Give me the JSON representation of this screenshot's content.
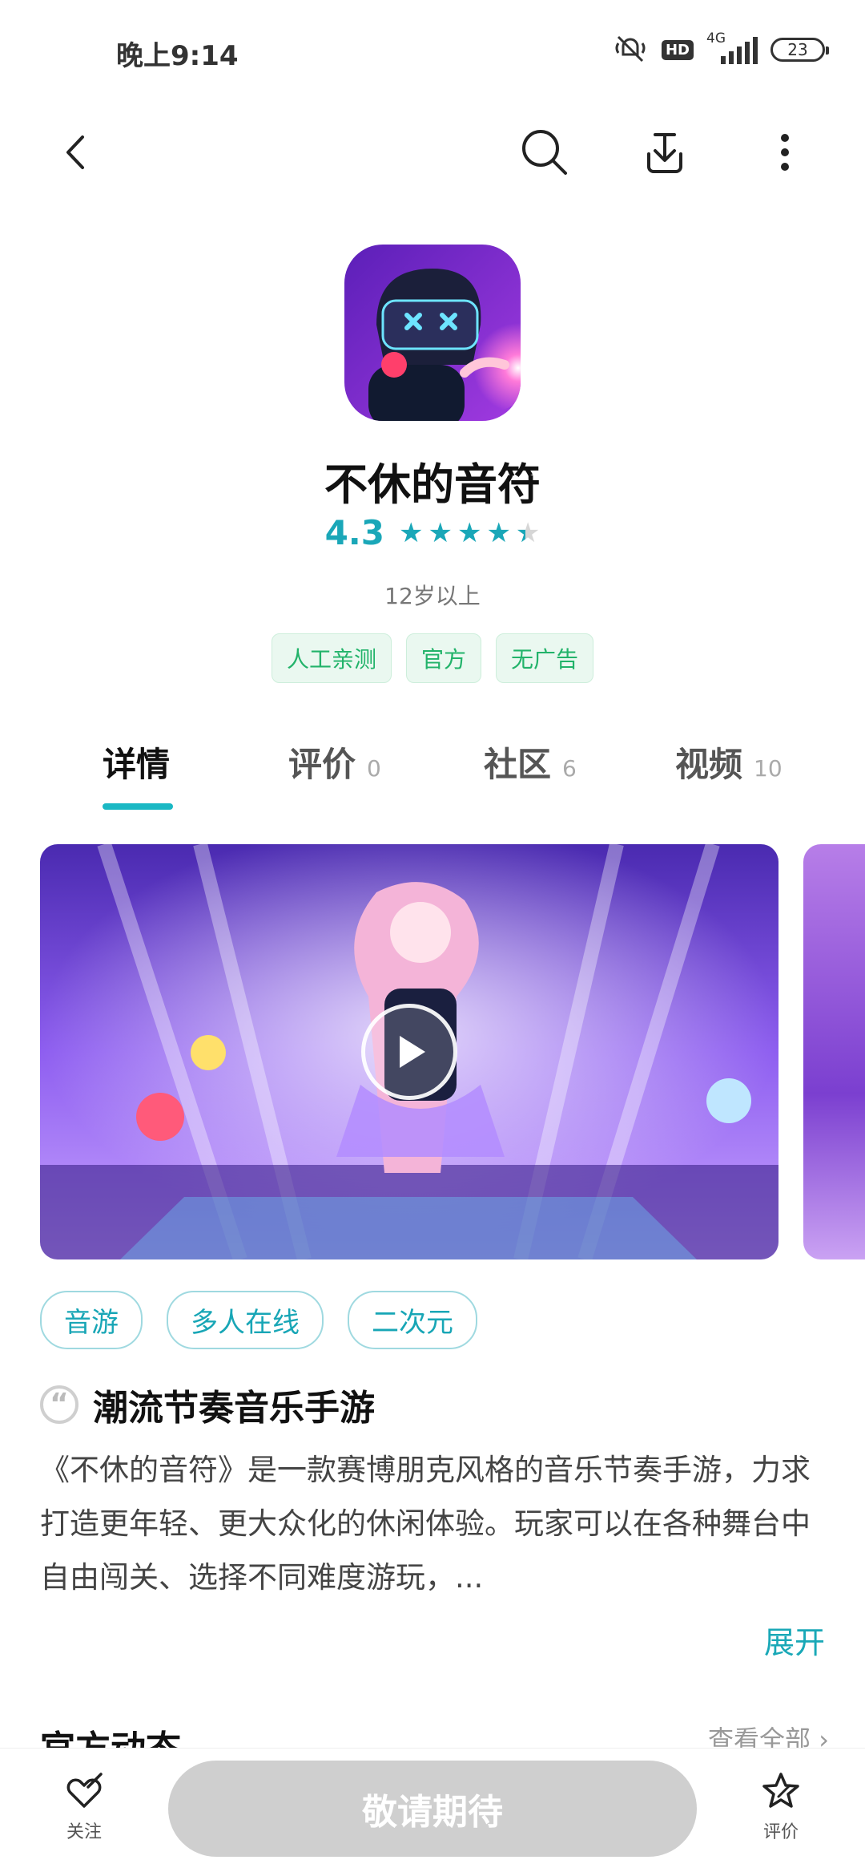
{
  "status_bar": {
    "time": "晚上9:14",
    "hd": "HD",
    "network": "4G",
    "battery": "23"
  },
  "app": {
    "name": "不休的音符",
    "rating": "4.3",
    "rating_value": 4.3,
    "age": "12岁以上",
    "badges": [
      "人工亲测",
      "官方",
      "无广告"
    ]
  },
  "tabs": [
    {
      "label": "详情",
      "count": ""
    },
    {
      "label": "评价",
      "count": "0"
    },
    {
      "label": "社区",
      "count": "6"
    },
    {
      "label": "视频",
      "count": "10"
    }
  ],
  "tags": [
    "音游",
    "多人在线",
    "二次元"
  ],
  "description": {
    "heading": "潮流节奏音乐手游",
    "text": "《不休的音符》是一款赛博朋克风格的音乐节奏手游，力求打造更年轻、更大众化的休闲体验。玩家可以在各种舞台中自由闯关、选择不同难度游玩，...",
    "expand": "展开"
  },
  "section_peek": {
    "title": "官方动态",
    "more": "查看全部 ›"
  },
  "bottom_bar": {
    "follow": "关注",
    "main_button": "敬请期待",
    "review": "评价"
  },
  "colors": {
    "accent": "#1aa7b8",
    "badge_green": "#22b36a",
    "disabled_button": "#cfcfcf"
  }
}
